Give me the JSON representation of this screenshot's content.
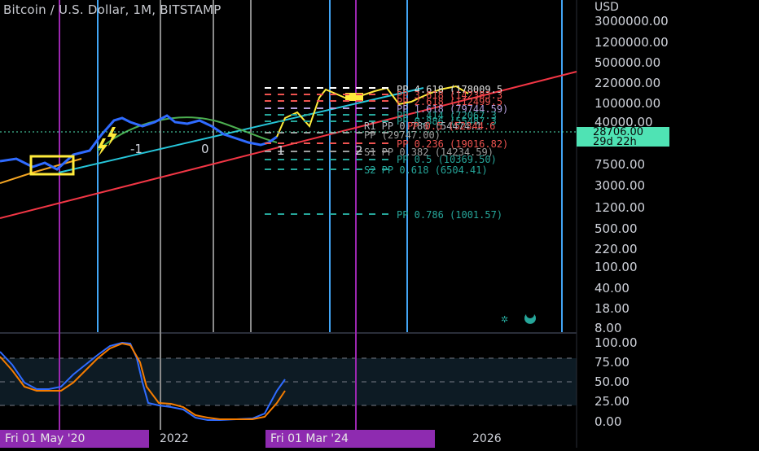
{
  "header": {
    "symbol_title": "Bitcoin / U.S. Dollar, 1M, BITSTAMP"
  },
  "price_axis": {
    "currency": "USD",
    "labels": [
      "3000000.00",
      "1200000.00",
      "500000.00",
      "220000.00",
      "100000.00",
      "40000.00",
      "7500.00",
      "3000.00",
      "1200.00",
      "500.00",
      "220.00",
      "100.00",
      "40.00",
      "18.00",
      "8.00"
    ]
  },
  "last_price": {
    "value": "28706.00",
    "countdown": "29d 22h"
  },
  "oscillator_axis": {
    "labels": [
      "100.00",
      "75.00",
      "50.00",
      "25.00",
      "0.00"
    ]
  },
  "time_axis": {
    "crosshair_left": "Fri 01 May '20",
    "year_a": "2022",
    "crosshair_right": "Fri 01 Mar '24",
    "year_b": "2026"
  },
  "pivot_labels": {
    "pp_4_618": "PP 4.618 (178009.5",
    "pp_r_a": "PP 3.618 (142383.3",
    "pp_r_b": "PP 2.618 (112499.5",
    "pp_1_618": "PP 1.618 (79744.59)",
    "pp_1_414": "PP 1.414 (72067.3",
    "pp_0_886": "PP 0.886 (55487.3",
    "r1_label": "R1 PP 0.786 (54474.1",
    "pp_0_5": "PP 0.5 (52344.6",
    "pp_main": "PP (29747.00)",
    "pp_0_236": "PP 0.236 (19016.82)",
    "s1_label": "S1 PP 0.382 (14234.59)",
    "pp_0_5_low": "PP 0.5 (10369.50)",
    "s2_label": "S2 PP 0.618 (6504.41)",
    "pp_0_786": "PP 0.786 (1001.57)"
  },
  "wave_labels": {
    "minus_one": "-1",
    "zero": "0",
    "one": "1",
    "two": "2"
  },
  "colors": {
    "price_line": "#2f6bff",
    "ema_orange": "#f5a623",
    "ema_green": "#4caf50",
    "trend_cyan": "#26c6da",
    "trend_red": "#f23645",
    "projection": "#ffeb3b",
    "stoch_k": "#2f6bff",
    "stoch_d": "#f57c00",
    "cycle_purple": "#9c27b0",
    "cycle_blue": "#42a5f5",
    "cycle_gray": "#9e9e9e",
    "badge": "#4fe3b4"
  },
  "icons": {
    "lightning": "lightning-icon",
    "moon": "moon-icon"
  }
}
